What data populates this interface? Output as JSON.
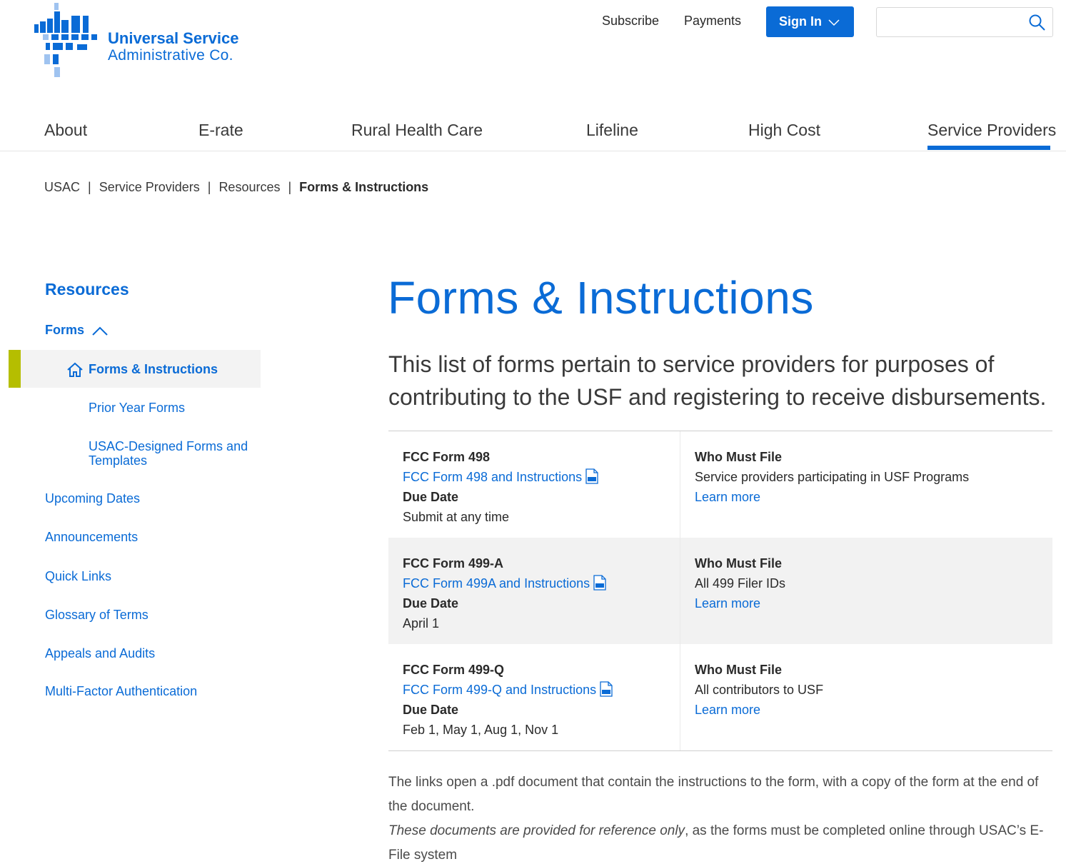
{
  "header": {
    "logo_line1": "Universal Service",
    "logo_line2": "Administrative Co.",
    "subscribe": "Subscribe",
    "payments": "Payments",
    "sign_in": "Sign In",
    "search_placeholder": ""
  },
  "nav": {
    "items": [
      "About",
      "E-rate",
      "Rural Health Care",
      "Lifeline",
      "High Cost",
      "Service Providers"
    ],
    "active": "Service Providers"
  },
  "breadcrumb": [
    "USAC",
    "Service Providers",
    "Resources",
    "Forms & Instructions"
  ],
  "sidebar": {
    "title": "Resources",
    "forms_label": "Forms",
    "active_item": "Forms & Instructions",
    "sub_items": [
      "Prior Year Forms",
      "USAC-Designed Forms and Templates"
    ],
    "links": [
      "Upcoming Dates",
      "Announcements",
      "Quick Links",
      "Glossary of Terms",
      "Appeals and Audits",
      "Multi-Factor Authentication"
    ]
  },
  "main": {
    "title": "Forms & Instructions",
    "intro": "This list of forms pertain to service providers for purposes of contributing to the USF and registering to receive disbursements.",
    "forms": [
      {
        "name": "FCC Form 498",
        "link": "FCC Form 498 and Instructions",
        "due_label": "Due Date",
        "due": "Submit at any time",
        "who_label": "Who Must File",
        "who": "Service providers participating in USF Programs",
        "learn": "Learn more"
      },
      {
        "name": "FCC Form 499-A",
        "link": "FCC Form 499A and Instructions",
        "due_label": "Due Date",
        "due": "April 1",
        "who_label": "Who Must File",
        "who": "All 499 Filer IDs",
        "learn": "Learn more"
      },
      {
        "name": "FCC Form 499-Q",
        "link": "FCC Form 499-Q and Instructions",
        "due_label": "Due Date",
        "due": "Feb 1, May 1, Aug 1, Nov 1",
        "who_label": "Who Must File",
        "who": "All contributors to USF",
        "learn": "Learn more"
      }
    ],
    "note_line1": "The links open a .pdf document that contain the instructions to the form, with a copy of the form at the end of the document.",
    "note_em": "These documents are provided for reference only",
    "note_rest": ", as the forms must be completed online through USAC’s E-File system"
  },
  "colors": {
    "brand_blue": "#0a6bd6",
    "active_marker": "#b5be00",
    "row_shade": "#f2f2f2"
  },
  "icons": [
    "search-icon",
    "chevron-down-icon",
    "chevron-up-icon",
    "home-icon",
    "pdf-icon"
  ]
}
